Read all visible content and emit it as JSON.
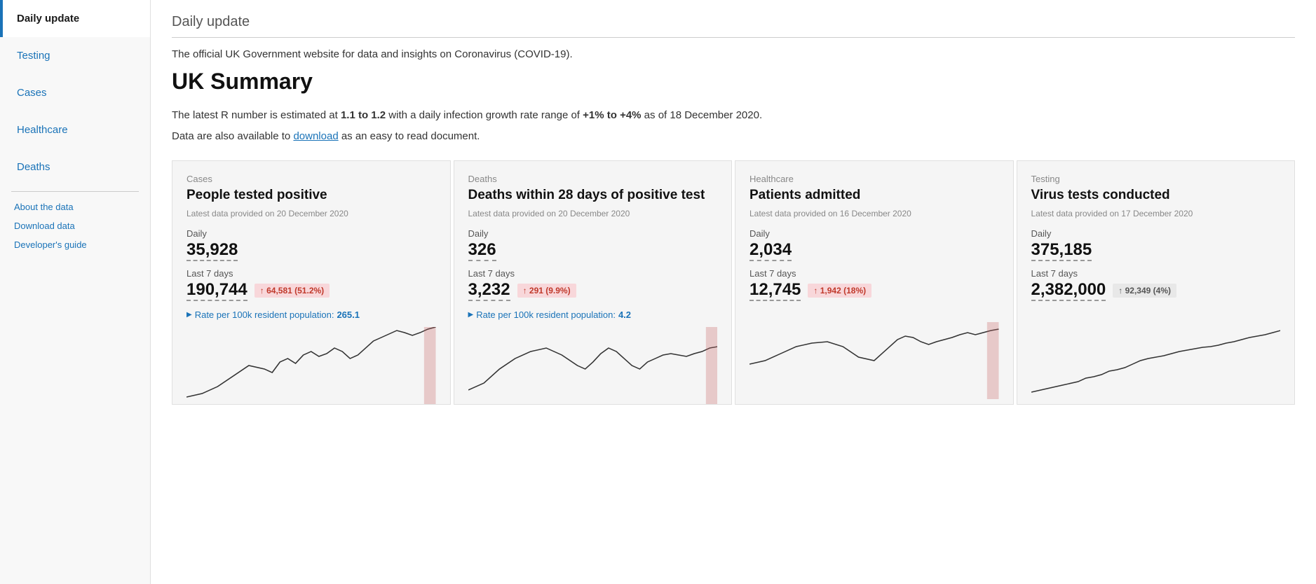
{
  "sidebar": {
    "items": [
      {
        "id": "daily-update",
        "label": "Daily update",
        "active": true
      },
      {
        "id": "testing",
        "label": "Testing",
        "active": false
      },
      {
        "id": "cases",
        "label": "Cases",
        "active": false
      },
      {
        "id": "healthcare",
        "label": "Healthcare",
        "active": false
      },
      {
        "id": "deaths",
        "label": "Deaths",
        "active": false
      }
    ],
    "sub_items": [
      {
        "id": "about-data",
        "label": "About the data"
      },
      {
        "id": "download-data",
        "label": "Download data"
      },
      {
        "id": "developers-guide",
        "label": "Developer's guide"
      }
    ]
  },
  "main": {
    "page_title": "Daily update",
    "subtitle": "The official UK Government website for data and insights on Coronavirus (COVID-19).",
    "heading": "UK Summary",
    "r_number_intro": "The latest R number is estimated at ",
    "r_number_value": "1.1 to 1.2",
    "r_number_mid": " with a daily infection growth rate range of ",
    "growth_rate": "+1% to +4%",
    "r_number_date": " as of 18 December 2020.",
    "download_text": "Data are also available to ",
    "download_link": "download",
    "download_suffix": " as an easy to read document.",
    "cards": [
      {
        "id": "cases-card",
        "category": "Cases",
        "title": "People tested positive",
        "date_label": "Latest data provided on 20 December 2020",
        "stat1_label": "Daily",
        "stat1_value": "35,928",
        "stat2_label": "Last 7 days",
        "stat2_value": "190,744",
        "badge": "↑ 64,581 (51.2%)",
        "badge_type": "red",
        "rate_label": "Rate per 100k resident population:",
        "rate_value": "265.1"
      },
      {
        "id": "deaths-card",
        "category": "Deaths",
        "title": "Deaths within 28 days of positive test",
        "date_label": "Latest data provided on 20 December 2020",
        "stat1_label": "Daily",
        "stat1_value": "326",
        "stat2_label": "Last 7 days",
        "stat2_value": "3,232",
        "badge": "↑ 291 (9.9%)",
        "badge_type": "red",
        "rate_label": "Rate per 100k resident population:",
        "rate_value": "4.2"
      },
      {
        "id": "healthcare-card",
        "category": "Healthcare",
        "title": "Patients admitted",
        "date_label": "Latest data provided on 16 December 2020",
        "stat1_label": "Daily",
        "stat1_value": "2,034",
        "stat2_label": "Last 7 days",
        "stat2_value": "12,745",
        "badge": "↑ 1,942 (18%)",
        "badge_type": "red",
        "rate_label": null,
        "rate_value": null
      },
      {
        "id": "testing-card",
        "category": "Testing",
        "title": "Virus tests conducted",
        "date_label": "Latest data provided on 17 December 2020",
        "stat1_label": "Daily",
        "stat1_value": "375,185",
        "stat2_label": "Last 7 days",
        "stat2_value": "2,382,000",
        "badge": "↑ 92,349 (4%)",
        "badge_type": "gray",
        "rate_label": null,
        "rate_value": null
      }
    ]
  }
}
